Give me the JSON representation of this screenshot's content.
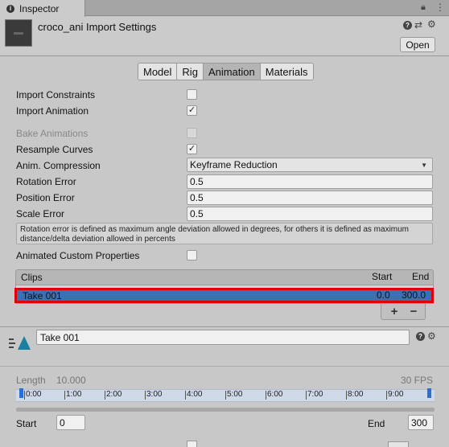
{
  "tab": {
    "label": "Inspector"
  },
  "header": {
    "title": "croco_ani Import Settings",
    "open_label": "Open"
  },
  "tabs": [
    "Model",
    "Rig",
    "Animation",
    "Materials"
  ],
  "settings": {
    "import_constraints": {
      "label": "Import Constraints",
      "checked": false
    },
    "import_animation": {
      "label": "Import Animation",
      "checked": true
    },
    "bake_animations": {
      "label": "Bake Animations",
      "checked": false,
      "disabled": true
    },
    "resample_curves": {
      "label": "Resample Curves",
      "checked": true
    },
    "anim_compression": {
      "label": "Anim. Compression",
      "value": "Keyframe Reduction"
    },
    "rotation_error": {
      "label": "Rotation Error",
      "value": "0.5"
    },
    "position_error": {
      "label": "Position Error",
      "value": "0.5"
    },
    "scale_error": {
      "label": "Scale Error",
      "value": "0.5"
    },
    "help_text": "Rotation error is defined as maximum angle deviation allowed in degrees, for others it is defined as maximum distance/delta deviation allowed in percents",
    "animated_custom_properties": {
      "label": "Animated Custom Properties",
      "checked": false
    }
  },
  "clips": {
    "header": "Clips",
    "start_header": "Start",
    "end_header": "End",
    "items": [
      {
        "name": "Take 001",
        "start": "0.0",
        "end": "300.0"
      }
    ],
    "add": "+",
    "remove": "−"
  },
  "clip": {
    "name": "Take 001",
    "length_label": "Length",
    "length_value": "10.000",
    "fps": "30 FPS",
    "ticks": [
      "0:00",
      "1:00",
      "2:00",
      "3:00",
      "4:00",
      "5:00",
      "6:00",
      "7:00",
      "8:00",
      "9:00"
    ],
    "start_label": "Start",
    "start_value": "0",
    "end_label": "End",
    "end_value": "300"
  },
  "colors": {
    "selection": "#3a72b0",
    "highlight_border": "#e00000"
  }
}
